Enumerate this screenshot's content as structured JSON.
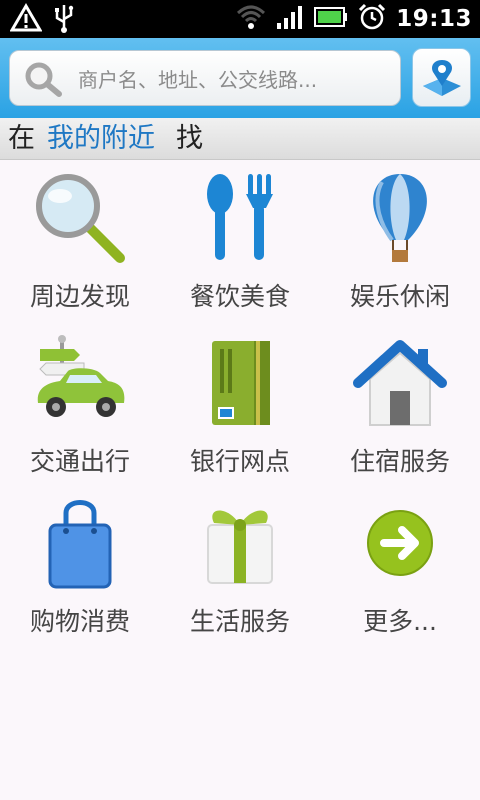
{
  "status_bar": {
    "time": "19:13",
    "icons": [
      "alert-icon",
      "usb-icon",
      "wifi-icon",
      "signal-icon",
      "battery-icon",
      "alarm-icon"
    ]
  },
  "search": {
    "placeholder": "商户名、地址、公交线路...",
    "value": ""
  },
  "location_bar": {
    "prefix": "在",
    "link": "我的附近",
    "suffix": "找"
  },
  "categories": [
    {
      "label": "周边发现",
      "icon": "magnifier-icon"
    },
    {
      "label": "餐饮美食",
      "icon": "spoon-fork-icon"
    },
    {
      "label": "娱乐休闲",
      "icon": "balloon-icon"
    },
    {
      "label": "交通出行",
      "icon": "car-icon"
    },
    {
      "label": "银行网点",
      "icon": "bank-card-icon"
    },
    {
      "label": "住宿服务",
      "icon": "house-icon"
    },
    {
      "label": "购物消费",
      "icon": "shopping-bag-icon"
    },
    {
      "label": "生活服务",
      "icon": "gift-icon"
    },
    {
      "label": "更多...",
      "icon": "arrow-right-icon"
    }
  ],
  "colors": {
    "header_blue": "#2aa2e4",
    "link_blue": "#1f78c4",
    "background": "#fbf7fb"
  }
}
